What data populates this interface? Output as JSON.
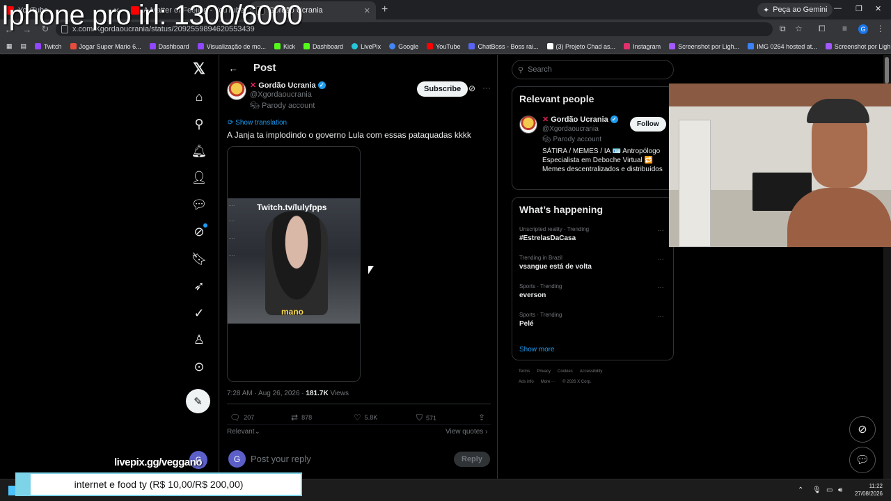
{
  "overlay": {
    "title": "Iphone pro irl: 1300/6000",
    "livepix": "livepix.gg/veggano",
    "alert": "internet e food ty (R$ 10,00/R$ 200,00)",
    "reply_avatar_letter": "G"
  },
  "browser": {
    "tabs": [
      {
        "label": "YouTube",
        "color": "#ff0000"
      },
      {
        "label": "A Matter of Feeling - YouTube",
        "color": "#ff0000"
      },
      {
        "label": "Gordão Ucrania",
        "color": "#111111"
      }
    ],
    "url": "x.com/Xgordaoucrania/status/2092559894620553439",
    "gemini_label": "Peça ao Gemini",
    "profile_letter": "G",
    "bookmarks": [
      {
        "label": "Twitch",
        "color": "#9146ff"
      },
      {
        "label": "Jogar Super Mario 6...",
        "color": "#e74c3c"
      },
      {
        "label": "Dashboard",
        "color": "#9146ff"
      },
      {
        "label": "Visualização de mo...",
        "color": "#9146ff"
      },
      {
        "label": "Kick",
        "color": "#53fc18"
      },
      {
        "label": "Dashboard",
        "color": "#53fc18"
      },
      {
        "label": "LivePix",
        "color": "#26c6da"
      },
      {
        "label": "Google",
        "color": "#4285f4"
      },
      {
        "label": "YouTube",
        "color": "#ff0000"
      },
      {
        "label": "ChatBoss - Boss rai...",
        "color": "#5865f2"
      },
      {
        "label": "(3) Projeto Chad as...",
        "color": "#ffffff"
      },
      {
        "label": "Instagram",
        "color": "#e1306c"
      },
      {
        "label": "Screenshot por Ligh...",
        "color": "#a259ff"
      },
      {
        "label": "IMG 0264 hosted at...",
        "color": "#3b82f6"
      },
      {
        "label": "Screenshot por Ligh...",
        "color": "#a259ff"
      }
    ]
  },
  "post": {
    "header_title": "Post",
    "author_name": "Gordão Ucrania",
    "author_handle": "@Xgordaoucrania",
    "parody_label": "Parody account",
    "subscribe_label": "Subscribe",
    "show_translation": "Show translation",
    "text": "A Janja ta implodindo o governo Lula com essas pataquadas kkkk",
    "video_twitch": "Twitch.tv/lulyfpps",
    "video_caption": "mano",
    "timestamp": "7:28 AM · Aug 26, 2026 · ",
    "views_count": "181.7K",
    "views_label": " Views",
    "replies": "207",
    "reposts": "878",
    "likes": "5.8K",
    "bookmarks": "571",
    "relevant_label": "Relevant",
    "view_quotes": "View quotes",
    "reply_placeholder": "Post your reply",
    "reply_button": "Reply"
  },
  "sidebar": {
    "search_placeholder": "Search",
    "relevant_title": "Relevant people",
    "person_name": "Gordão Ucrania",
    "person_handle": "@Xgordaoucrania",
    "person_parody": "Parody account",
    "follow_label": "Follow",
    "person_bio": "SÁTIRA / MEMES / IA 🪪 Antropólogo Especialista em Deboche Virtual 🔁 Memes descentralizados e distribuídos",
    "happening_title": "What’s happening",
    "trends": [
      {
        "category": "Unscripted reality · Trending",
        "name": "#EstrelasDaCasa"
      },
      {
        "category": "Trending in Brazil",
        "name": "vsangue está de volta"
      },
      {
        "category": "Sports · Trending",
        "name": "everson"
      },
      {
        "category": "Sports · Trending",
        "name": "Pelé"
      }
    ],
    "show_more": "Show more",
    "footer_row1": [
      "Terms",
      "Privacy",
      "Cookies",
      "Accessibility"
    ],
    "footer_row2": [
      "Ads info",
      "More ···",
      "© 2026 X Corp."
    ]
  },
  "taskbar": {
    "time": "11:22",
    "date": "27/08/2026"
  },
  "colors": {
    "accent": "#1d9bf0",
    "background": "#000000",
    "alert_border": "#7dd3e8"
  }
}
